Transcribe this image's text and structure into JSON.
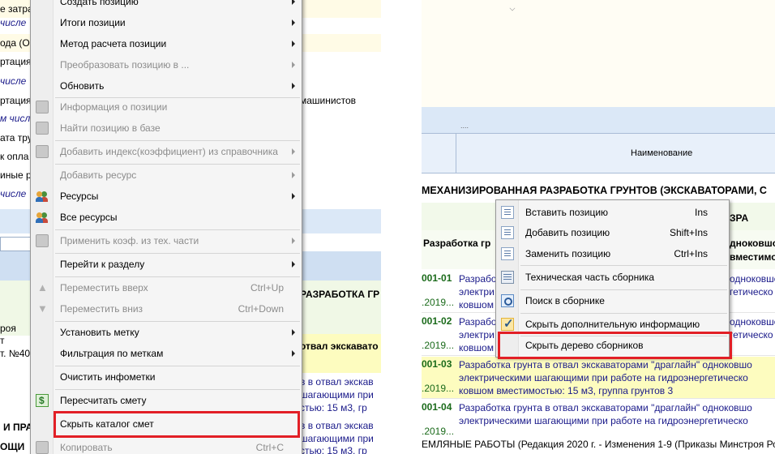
{
  "left_background": {
    "rows": [
      {
        "text": "е затра"
      },
      {
        "text": "числе",
        "italic": true
      },
      {
        "text": "ода (ОТ"
      },
      {
        "text": "ртация ма"
      },
      {
        "text": "числе",
        "italic": true
      },
      {
        "text": "ртация"
      },
      {
        "text": "м числе",
        "italic": true
      },
      {
        "text": "ата труд"
      },
      {
        "text": "к опла"
      },
      {
        "text": "иные ре"
      },
      {
        "text": "числе",
        "italic": true
      }
    ],
    "operator_text": "машинистов",
    "heading_fragment": "РАЗРАБОТКА ГР",
    "block_lines": [
      "роя",
      "т",
      "т. №40"
    ],
    "yellow_fragment": "отвал экскавато",
    "bottom_lines": [
      "в в отвал экскав",
      "шагающими при",
      "стью: 15 м3, гр",
      "в в отвал экскав",
      "шагающими при",
      "стью: 15 м3, гр"
    ],
    "bottom_left": [
      "И ПРА",
      "ОЩИ"
    ]
  },
  "right_background": {
    "header_column": "Наименование",
    "dots": "....",
    "section_heading": "МЕХАНИЗИРОВАННАЯ РАЗРАБОТКА ГРУНТОВ (ЭКСКАВАТОРАМИ, С",
    "heading_right": "ЗРА",
    "subheading": "Разработка гр",
    "subheading_right": [
      "дноковшо",
      "вместимо"
    ],
    "entries": [
      {
        "code": "001-01",
        "date": ".2019...",
        "lines": [
          "Разработ",
          "электри",
          "ковшом"
        ],
        "right": [
          "одноковшо",
          "гетическо"
        ]
      },
      {
        "code": "001-02",
        "date": ".2019...",
        "lines": [
          "Разработ",
          "электри",
          "ковшом"
        ],
        "right": [
          "одноковшо",
          "гетическо"
        ]
      },
      {
        "code": "001-03",
        "date": ".2019...",
        "lines": [
          "Разработка грунта в отвал экскаваторами \"драглайн\" одноковшо",
          "электрическими шагающими при работе на гидроэнергетическо",
          "ковшом вместимостью: 15 м3, группа грунтов 3"
        ]
      },
      {
        "code": "001-04",
        "date": ".2019...",
        "lines": [
          "Разработка грунта в отвал экскаваторами \"драглайн\" одноковшо",
          "электрическими шагающими при работе на гидроэнергетическо"
        ]
      }
    ],
    "footer": "ЕМЛЯНЫЕ РАБОТЫ (Редакция 2020 г. - Изменения 1-9 (Приказы Минстроя России от"
  },
  "left_menu": {
    "items": [
      {
        "label": "Создать позицию",
        "disabled": false,
        "arrow": true,
        "icon": ""
      },
      {
        "label": "Итоги позиции",
        "disabled": false,
        "arrow": true,
        "icon": ""
      },
      {
        "label": "Метод расчета позиции",
        "disabled": false,
        "arrow": true,
        "icon": ""
      },
      {
        "label": "Преобразовать позицию в ...",
        "disabled": true,
        "arrow": true,
        "icon": ""
      },
      {
        "label": "Обновить",
        "disabled": false,
        "arrow": true,
        "icon": ""
      },
      {
        "label": "Информация о позиции",
        "disabled": true,
        "arrow": false,
        "icon": "info-icon"
      },
      {
        "label": "Найти позицию в базе",
        "disabled": true,
        "arrow": false,
        "icon": "find-icon"
      },
      {
        "label": "Добавить индекс(коэффициент) из справочника",
        "disabled": true,
        "arrow": true,
        "icon": "index-icon"
      },
      {
        "label": "Добавить ресурс",
        "disabled": true,
        "arrow": true,
        "icon": ""
      },
      {
        "label": "Ресурсы",
        "disabled": false,
        "arrow": true,
        "icon": "resources-icon"
      },
      {
        "label": "Все ресурсы",
        "disabled": false,
        "arrow": false,
        "icon": "all-resources-icon"
      },
      {
        "label": "Применить коэф. из тех. части",
        "disabled": true,
        "arrow": true,
        "icon": "coef-icon"
      },
      {
        "label": "Перейти к разделу",
        "disabled": false,
        "arrow": true,
        "icon": ""
      },
      {
        "label": "Переместить вверх",
        "disabled": true,
        "arrow": false,
        "icon": "arrow-up-icon",
        "shortcut": "Ctrl+Up"
      },
      {
        "label": "Переместить вниз",
        "disabled": true,
        "arrow": false,
        "icon": "arrow-down-icon",
        "shortcut": "Ctrl+Down"
      },
      {
        "label": "Установить метку",
        "disabled": false,
        "arrow": true,
        "icon": ""
      },
      {
        "label": "Фильтрация по меткам",
        "disabled": false,
        "arrow": true,
        "icon": ""
      },
      {
        "label": "Очистить инфометки",
        "disabled": false,
        "arrow": false,
        "icon": ""
      },
      {
        "label": "Пересчитать смету",
        "disabled": false,
        "arrow": false,
        "icon": "recalc-icon"
      },
      {
        "label": "Скрыть каталог смет",
        "disabled": false,
        "arrow": false,
        "icon": ""
      },
      {
        "label": "Копировать",
        "disabled": true,
        "arrow": false,
        "icon": "copy-icon",
        "shortcut": "Ctrl+C"
      }
    ]
  },
  "right_menu": {
    "items": [
      {
        "label": "Вставить позицию",
        "shortcut": "Ins",
        "icon": "insert-position-icon"
      },
      {
        "label": "Добавить позицию",
        "shortcut": "Shift+Ins",
        "icon": "add-position-icon"
      },
      {
        "label": "Заменить позицию",
        "shortcut": "Ctrl+Ins",
        "icon": "replace-position-icon"
      },
      {
        "label": "Техническая часть сборника",
        "shortcut": "",
        "icon": "tech-part-icon"
      },
      {
        "label": "Поиск в сборнике",
        "shortcut": "",
        "icon": "search-collection-icon"
      },
      {
        "label": "Скрыть дополнительную информацию",
        "shortcut": "",
        "icon": "check-icon"
      },
      {
        "label": "Скрыть дерево сборников",
        "shortcut": "",
        "icon": ""
      }
    ]
  },
  "colors": {
    "highlight_box": "#e21f26",
    "menu_bg": "#f5f5f5",
    "disabled_text": "#8c8c8c",
    "code_green": "#1a6a1a",
    "link_blue": "#1a1a8a"
  }
}
